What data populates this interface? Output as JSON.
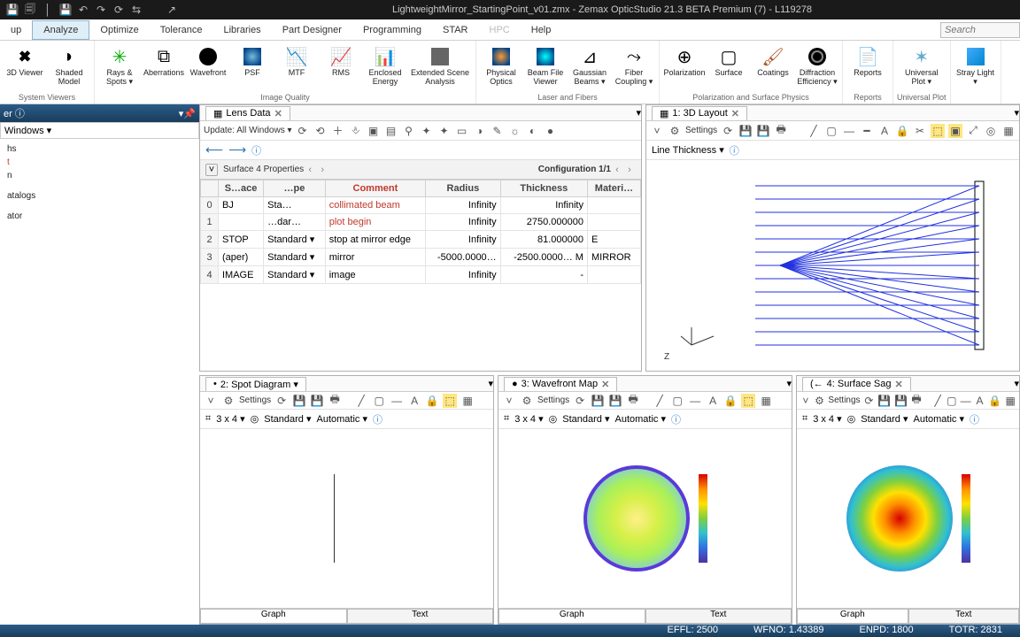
{
  "title": "LightweightMirror_StartingPoint_v01.zmx - Zemax OpticStudio 21.3 BETA  Premium (7) - L119278",
  "search_placeholder": "Search",
  "menus": [
    "up",
    "Analyze",
    "Optimize",
    "Tolerance",
    "Libraries",
    "Part Designer",
    "Programming",
    "STAR",
    "HPC",
    "Help"
  ],
  "active_menu": 1,
  "ribbon_groups": [
    {
      "label": "System Viewers",
      "buttons": [
        {
          "label": "3D\nViewer",
          "icon": "cube"
        },
        {
          "label": "Shaded\nModel",
          "icon": "shaded"
        }
      ]
    },
    {
      "label": "Image Quality",
      "buttons": [
        {
          "label": "Rays &\nSpots ▾",
          "icon": "rays"
        },
        {
          "label": "Aberrations",
          "icon": "aber"
        },
        {
          "label": "Wavefront",
          "icon": "aperture"
        },
        {
          "label": "PSF",
          "icon": "psf"
        },
        {
          "label": "MTF",
          "icon": "mtf"
        },
        {
          "label": "RMS",
          "icon": "rms"
        },
        {
          "label": "Enclosed\nEnergy",
          "icon": "ee"
        },
        {
          "label": "Extended Scene\nAnalysis",
          "icon": "es"
        }
      ]
    },
    {
      "label": "Laser and Fibers",
      "buttons": [
        {
          "label": "Physical\nOptics",
          "icon": "po"
        },
        {
          "label": "Beam File\nViewer",
          "icon": "bf"
        },
        {
          "label": "Gaussian\nBeams ▾",
          "icon": "gb"
        },
        {
          "label": "Fiber\nCoupling ▾",
          "icon": "fiber"
        }
      ]
    },
    {
      "label": "Polarization and Surface Physics",
      "buttons": [
        {
          "label": "Polarization",
          "icon": "pol"
        },
        {
          "label": "Surface",
          "icon": "surf"
        },
        {
          "label": "Coatings",
          "icon": "coat"
        },
        {
          "label": "Diffraction\nEfficiency ▾",
          "icon": "diff"
        }
      ]
    },
    {
      "label": "Reports",
      "buttons": [
        {
          "label": "Reports",
          "icon": "rep"
        }
      ]
    },
    {
      "label": "Universal Plot",
      "buttons": [
        {
          "label": "Universal\nPlot ▾",
          "icon": "uplot"
        }
      ]
    },
    {
      "label": "",
      "buttons": [
        {
          "label": "Stray\nLight ▾",
          "icon": "star"
        }
      ]
    }
  ],
  "sysexp_tab": "er ⓘ",
  "sysexp_dropdown": "Windows ▾",
  "tree": [
    "hs",
    "t",
    "n",
    "",
    "",
    "atalogs",
    "",
    "",
    "ator"
  ],
  "tree_sel": 1,
  "lens_tab": "Lens Data",
  "update_label": "Update: All Windows ▾",
  "cfg_title": "Surface 4 Properties",
  "cfg_label": "Configuration 1/1",
  "lde_cols": [
    "",
    "S…ace",
    "…pe",
    "Comment",
    "Radius",
    "Thickness",
    "Materi…"
  ],
  "lde_rows": [
    {
      "n": "0",
      "surf": "BJ",
      "type": "Sta…",
      "comment": "collimated beam",
      "radius": "Infinity",
      "thick": "Infinity",
      "mat": ""
    },
    {
      "n": "1",
      "surf": "",
      "type": "…dar…",
      "comment": "plot begin",
      "radius": "Infinity",
      "thick": "2750.000000",
      "mat": ""
    },
    {
      "n": "2",
      "surf": "STOP",
      "type": "Standard ▾",
      "comment": "stop at mirror edge",
      "radius": "Infinity",
      "thick": "81.000000",
      "mat": "E"
    },
    {
      "n": "3",
      "surf": "(aper)",
      "type": "Standard ▾",
      "comment": "mirror",
      "radius": "-5000.0000…",
      "thick": "-2500.0000… M",
      "mat": "MIRROR"
    },
    {
      "n": "4",
      "surf": "IMAGE",
      "type": "Standard ▾",
      "comment": "image",
      "radius": "Infinity",
      "thick": "-",
      "mat": ""
    }
  ],
  "layout_tab": "1: 3D Layout",
  "layout_settings": "Settings",
  "line_thickness": "Line Thickness ▾",
  "axis_label": "Z",
  "panes": [
    {
      "tab": "2: Spot Diagram ▾",
      "settings": "Settings",
      "grid": "3 x 4 ▾",
      "std": "Standard ▾",
      "auto": "Automatic ▾",
      "graph": "Graph",
      "text": "Text"
    },
    {
      "tab": "3: Wavefront Map",
      "settings": "Settings",
      "grid": "3 x 4 ▾",
      "std": "Standard ▾",
      "auto": "Automatic ▾",
      "graph": "Graph",
      "text": "Text"
    },
    {
      "tab": "4: Surface Sag",
      "settings": "Settings",
      "grid": "3 x 4 ▾",
      "std": "Standard ▾",
      "auto": "Automatic ▾",
      "graph": "Graph",
      "text": "Text"
    }
  ],
  "status": [
    "EFFL: 2500",
    "WFNO: 1.43389",
    "ENPD: 1800",
    "TOTR: 2831"
  ]
}
